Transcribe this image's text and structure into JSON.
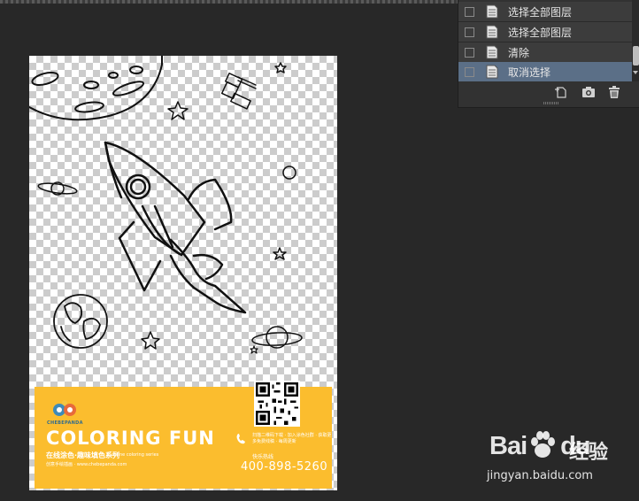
{
  "history_panel": {
    "items": [
      {
        "label": "选择全部图层",
        "selected": false
      },
      {
        "label": "选择全部图层",
        "selected": false
      },
      {
        "label": "清除",
        "selected": false
      },
      {
        "label": "取消选择",
        "selected": true
      }
    ],
    "footer_icons": [
      "new-document-icon",
      "camera-icon",
      "trash-icon"
    ],
    "selected_color": "#5b6f87"
  },
  "document": {
    "banner": {
      "logo_text": "CHEBEPANDA",
      "headline": "COLORING FUN",
      "subtitle": "在线涂色·趣味填色系列",
      "subtitle_small": "online coloring series",
      "tagline": "创意手绘插画 · www.chebepanda.com",
      "fine_print": "扫描二维码下载 · 加入涂色社群 · 获取更多免费线稿 · 每周更新",
      "contact_label": "快乐热线",
      "phone": "400-898-5260"
    },
    "background_color": "#fbbd2e"
  },
  "watermark": {
    "brand": "Bai",
    "brand_suffix": "du",
    "brand_cn": "经验",
    "url": "jingyan.baidu.com"
  }
}
